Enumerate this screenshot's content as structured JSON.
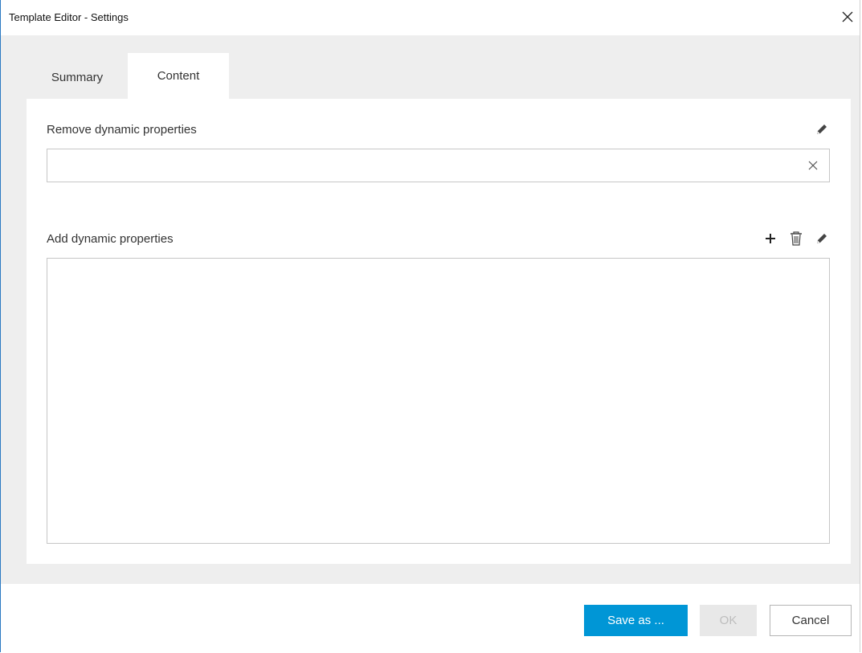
{
  "window": {
    "title": "Template Editor - Settings",
    "close_icon": "close-icon"
  },
  "tabs": [
    {
      "label": "Summary",
      "active": false
    },
    {
      "label": "Content",
      "active": true
    }
  ],
  "remove_section": {
    "label": "Remove dynamic properties",
    "edit_icon": "pencil-icon",
    "input_value": "",
    "clear_icon": "clear-icon"
  },
  "add_section": {
    "label": "Add dynamic properties",
    "icons": [
      "plus-icon",
      "trash-icon",
      "pencil-icon"
    ],
    "items": []
  },
  "footer": {
    "save_as_label": "Save as ...",
    "ok_label": "OK",
    "ok_disabled": true,
    "cancel_label": "Cancel"
  },
  "colors": {
    "accent": "#0096d6",
    "window_border": "#2b79c2",
    "background": "#eeeeee"
  }
}
